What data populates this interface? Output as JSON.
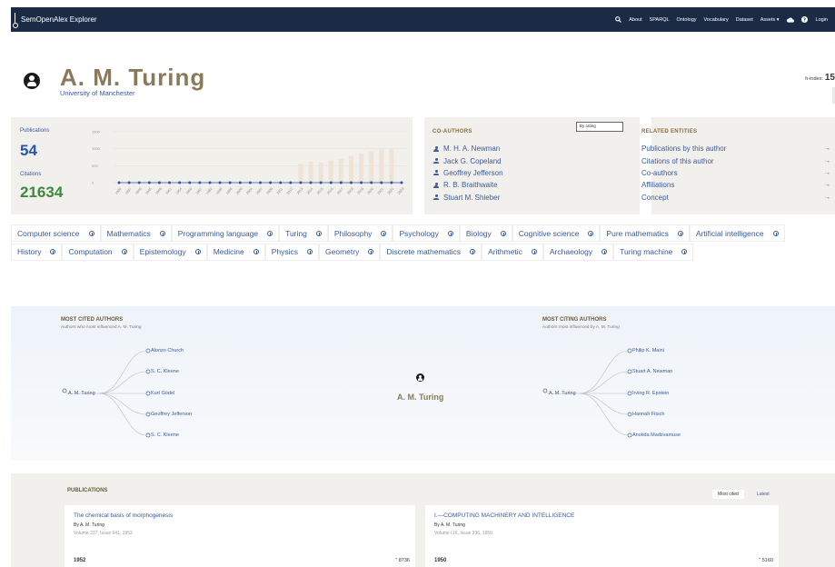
{
  "app": {
    "title": "SemOpenAlex Explorer"
  },
  "nav": {
    "about": "About",
    "sparql": "SPARQL",
    "ontology": "Ontology",
    "vocabulary": "Vocabulary",
    "dataset": "Dataset",
    "assets": "Assets ▾",
    "login": "Login"
  },
  "icons": {
    "search": "search-icon",
    "cloud": "cloud-icon",
    "help": "question-icon",
    "user": "user-icon"
  },
  "author": {
    "name": "A. M. Turing",
    "affiliation": "University of Manchester",
    "hindex_label": "h-index:",
    "hindex_value": "15"
  },
  "stats": {
    "publications_label": "Publications",
    "publications_value": "54",
    "citations_label": "Citations",
    "citations_value": "21634"
  },
  "chart_data": {
    "type": "bar",
    "years": [
      "1930",
      "1937",
      "1940",
      "1946",
      "1949",
      "1951",
      "1954",
      "1960",
      "1967",
      "1982",
      "1990",
      "1995",
      "2000",
      "2004",
      "2007",
      "2009",
      "2011",
      "2012",
      "2013",
      "2014",
      "2015",
      "2016",
      "2017",
      "2018",
      "2019",
      "2020",
      "2021",
      "2022",
      "2023"
    ],
    "citations": [
      0,
      0,
      0,
      0,
      0,
      0,
      0,
      0,
      0,
      0,
      0,
      0,
      0,
      0,
      0,
      0,
      0,
      0,
      560,
      620,
      590,
      650,
      700,
      790,
      860,
      910,
      980,
      980,
      0
    ],
    "publications": [
      1,
      1,
      1,
      1,
      1,
      1,
      1,
      1,
      1,
      1,
      1,
      1,
      1,
      1,
      1,
      1,
      1,
      1,
      1,
      1,
      1,
      1,
      1,
      1,
      1,
      1,
      1,
      1,
      1
    ],
    "yticks": [
      "1500",
      "1000",
      "500",
      "0"
    ],
    "ylim": [
      0,
      1500
    ],
    "colors": {
      "bars": "#eee3d4",
      "line": "#2b55a8"
    }
  },
  "coauthors": {
    "title": "CO-AUTHORS",
    "sort": "By rating",
    "items": [
      "M. H. A. Newman",
      "Jack G. Copeland",
      "Geoffrey Jefferson",
      "R. B. Braithwaite",
      "Stuart M. Shieber"
    ]
  },
  "related": {
    "title": "RELATED ENTITIES",
    "items": [
      "Publications by this author",
      "Citations of this author",
      "Co-authors",
      "Affiliations",
      "Concept"
    ],
    "arrow": "→"
  },
  "concepts": [
    "Computer science",
    "Mathematics",
    "Programming language",
    "Turing",
    "Philosophy",
    "Psychology",
    "Biology",
    "Cognitive science",
    "Pure mathematics",
    "Artificial intelligence",
    "History",
    "Computation",
    "Epistemology",
    "Medicine",
    "Physics",
    "Geometry",
    "Discrete mathematics",
    "Arithmetic",
    "Archaeology",
    "Turing machine"
  ],
  "influence": {
    "cited_title": "MOST CITED AUTHORS",
    "cited_sub": "Authors who most influenced A. M. Turing",
    "citing_title": "MOST CITING AUTHORS",
    "citing_sub": "Authors most influenced by A. M. Turing",
    "center_name": "A. M. Turing",
    "cited_root": "A. M. Turing",
    "cited": [
      "Alonzo Church",
      "S. C. Kleene",
      "Kurt Gödel",
      "Geoffrey Jefferson",
      "S. C. Kleene"
    ],
    "citing_root": "A. M. Turing",
    "citing": [
      "Philip K. Maini",
      "Stuart A. Newman",
      "Irving R. Epstein",
      "Hannah Fitsch",
      "Anotida Madzvamuse"
    ]
  },
  "publications": {
    "title": "PUBLICATIONS",
    "tab_cited": "Most cited",
    "tab_latest": "Latest",
    "items": [
      {
        "title": "The chemical basis of morphogenesis",
        "by": "By A. M. Turing",
        "volume": "Volume 237, Issue 641, 1952",
        "year": "1952",
        "citations": "” 8736"
      },
      {
        "title": "I.—COMPUTING MACHINERY AND INTELLIGENCE",
        "by": "By A. M. Turing",
        "volume": "Volume LIX, Issue 236, 1950",
        "year": "1950",
        "citations": "” 5160"
      }
    ]
  }
}
